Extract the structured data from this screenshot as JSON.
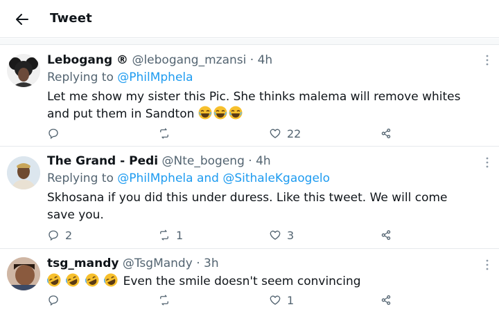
{
  "header": {
    "title": "Tweet"
  },
  "tweets": [
    {
      "name": "Lebogang ®",
      "handle": "@lebogang_mzansi",
      "time": "· 4h",
      "reply_prefix": "Replying to",
      "reply_to": "@PhilMphela",
      "text": "Let me show my sister this Pic. She thinks malema will remove whites and put them in Sandton",
      "emojis": [
        "laughing",
        "laughing",
        "laughing"
      ],
      "replies": "",
      "retweets": "",
      "likes": "22"
    },
    {
      "name": "The Grand - Pedi",
      "handle": "@Nte_bogeng",
      "time": "· 4h",
      "reply_prefix": "Replying to",
      "reply_to": "@PhilMphela and @SithaleKgaogelo",
      "text": "Skhosana if you did this under duress. Like this tweet. We will come save you.",
      "emojis": [],
      "replies": "2",
      "retweets": "1",
      "likes": "3"
    },
    {
      "name": "tsg_mandy",
      "handle": "@TsgMandy",
      "time": "· 3h",
      "reply_prefix": "",
      "reply_to": "",
      "text": "Even the smile doesn't seem convincing",
      "emojis": [
        "rofl",
        "rofl",
        "rofl",
        "rofl"
      ],
      "replies": "",
      "retweets": "",
      "likes": "1"
    }
  ],
  "colors": {
    "accent": "#1d9bf0",
    "muted": "#536471",
    "text": "#0f1419",
    "divider": "#e6e9ec"
  },
  "icons": [
    "back-arrow-icon",
    "more-icon",
    "reply-icon",
    "retweet-icon",
    "like-icon",
    "share-icon",
    "laughing-emoji",
    "rofl-emoji"
  ]
}
